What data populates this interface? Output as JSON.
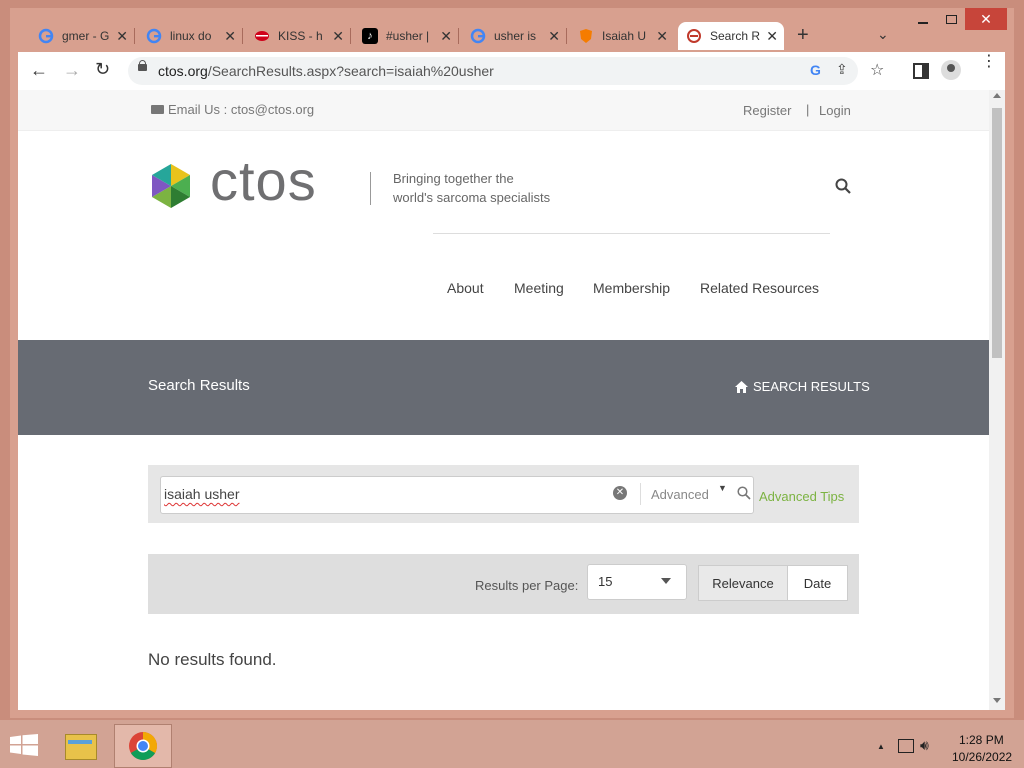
{
  "browser": {
    "tabs": [
      {
        "title": "gmer - G",
        "icon": "google-icon"
      },
      {
        "title": "linux do",
        "icon": "google-icon"
      },
      {
        "title": "KISS - h",
        "icon": "lips-icon"
      },
      {
        "title": "#usher |",
        "icon": "tiktok-icon"
      },
      {
        "title": "usher is",
        "icon": "google-icon"
      },
      {
        "title": "Isaiah U",
        "icon": "shield-icon"
      },
      {
        "title": "Search R",
        "icon": "ctos-icon",
        "active": true
      }
    ],
    "url_domain": "ctos.org",
    "url_path": "/SearchResults.aspx?search=isaiah%20usher"
  },
  "topbar": {
    "email_label": "Email Us : ctos@ctos.org",
    "register": "Register",
    "separator": "|",
    "login": "Login"
  },
  "brand": {
    "name": "ctos",
    "tagline_line1": "Bringing together the",
    "tagline_line2": "world's sarcoma specialists"
  },
  "nav": {
    "items": [
      "About",
      "Meeting",
      "Membership",
      "Related Resources"
    ]
  },
  "banner": {
    "title": "Search Results",
    "breadcrumb": "SEARCH RESULTS",
    "color": "#676b73"
  },
  "search": {
    "query": "isaiah usher",
    "advanced_label": "Advanced",
    "advanced_tips": "Advanced Tips",
    "tips_color": "#7cb342"
  },
  "results_bar": {
    "per_page_label": "Results per Page:",
    "per_page_value": "15",
    "sort_options": [
      "Relevance",
      "Date"
    ],
    "selected_sort": "Relevance"
  },
  "results": {
    "message": "No results found."
  },
  "taskbar": {
    "time": "1:28 PM",
    "date": "10/26/2022"
  }
}
